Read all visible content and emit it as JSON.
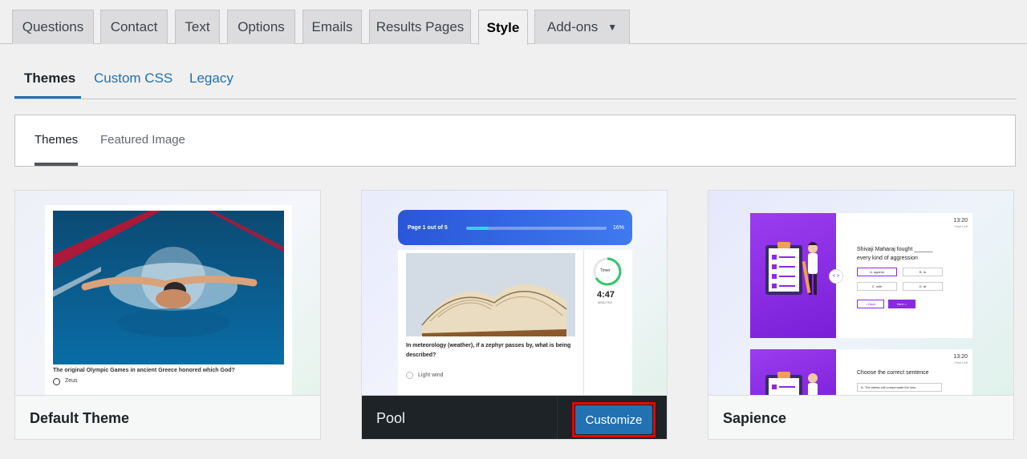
{
  "main_tabs": [
    "Questions",
    "Contact",
    "Text",
    "Options",
    "Emails",
    "Results Pages",
    "Style",
    "Add-ons"
  ],
  "main_tab_active": "Style",
  "sub_tabs": [
    "Themes",
    "Custom CSS",
    "Legacy"
  ],
  "panel_tabs": [
    "Themes",
    "Featured Image"
  ],
  "themes": [
    {
      "name": "Default Theme",
      "preview": {
        "question": "The original Olympic Games in ancient Greece honored which God?",
        "option": "Zeus"
      }
    },
    {
      "name": "Pool",
      "action": "Customize",
      "preview": {
        "page_label": "Page 1 out of 5",
        "progress": "16%",
        "timer_label": "Timer",
        "timer_value": "4:47",
        "timer_unit": "MINUTES",
        "question": "In meteorology (weather), if a zephyr passes by, what is being described?",
        "option": "Light wind"
      }
    },
    {
      "name": "Sapience",
      "preview": {
        "time": "13:20",
        "time_label": "Time Left",
        "question": "Shivaji Maharaj fought ______ every kind of aggression",
        "options": [
          "A. against",
          "B. to",
          "C. with",
          "D. at"
        ],
        "back": "< Back",
        "next": "Next >",
        "question2": "Choose the correct sentence",
        "option2": "A. The sheep will compensate the loss."
      }
    }
  ],
  "colors": {
    "accent": "#2271b1",
    "highlight": "#ee0000",
    "sapience_purple": "#8a2be2"
  }
}
